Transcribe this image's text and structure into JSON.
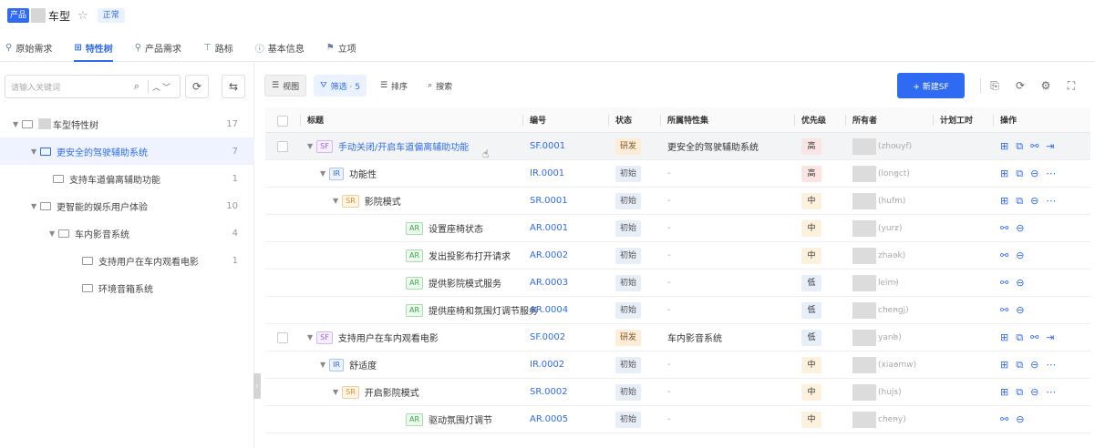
{
  "header": {
    "product_badge": "产品",
    "model_name": "车型",
    "status": "正常"
  },
  "tabs": [
    {
      "label": "原始需求",
      "icon": "pin-icon"
    },
    {
      "label": "特性树",
      "icon": "tree-icon",
      "active": true
    },
    {
      "label": "产品需求",
      "icon": "pin-icon"
    },
    {
      "label": "路标",
      "icon": "signpost-icon"
    },
    {
      "label": "基本信息",
      "icon": "info-icon"
    },
    {
      "label": "立项",
      "icon": "flag-icon"
    }
  ],
  "left_panel": {
    "search_placeholder": "请输入关键词",
    "tree": [
      {
        "label": "车型特性树",
        "count": "17",
        "level": 0
      },
      {
        "label": "更安全的驾驶辅助系统",
        "count": "7",
        "level": 1,
        "selected": true
      },
      {
        "label": "支持车道偏离辅助功能",
        "count": "1",
        "level": 2
      },
      {
        "label": "更智能的娱乐用户体验",
        "count": "10",
        "level": 1
      },
      {
        "label": "车内影音系统",
        "count": "4",
        "level": 2
      },
      {
        "label": "支持用户在车内观看电影",
        "count": "1",
        "level": 3
      },
      {
        "label": "环境音箱系统",
        "count": "",
        "level": 3
      }
    ]
  },
  "toolbar": {
    "view": "视图",
    "filter": "筛选 · 5",
    "sort": "排序",
    "search": "搜索",
    "new_button": "+ 新建SF"
  },
  "table": {
    "columns": [
      "标题",
      "编号",
      "状态",
      "所属特性集",
      "优先级",
      "所有者",
      "计划工时",
      "操作"
    ],
    "rows": [
      {
        "type": "SF",
        "title": "手动关闭/开启车道偏离辅助功能",
        "code": "SF.0001",
        "status": "研发",
        "feature_set": "更安全的驾驶辅助系统",
        "priority": "高",
        "owner": "(zhouyf)",
        "hours": "-",
        "level": 0,
        "has_checkbox": true,
        "ops": [
          "tree",
          "copy",
          "split",
          "export"
        ]
      },
      {
        "type": "IR",
        "title": "功能性",
        "code": "IR.0001",
        "status": "初始",
        "feature_set": "-",
        "priority": "高",
        "owner": "(longct)",
        "hours": "-",
        "level": 1,
        "ops": [
          "tree",
          "copy",
          "minus",
          "more"
        ]
      },
      {
        "type": "SR",
        "title": "影院模式",
        "code": "SR.0001",
        "status": "初始",
        "feature_set": "-",
        "priority": "中",
        "owner": "(hufm)",
        "hours": "-",
        "level": 2,
        "ops": [
          "tree",
          "copy",
          "minus",
          "more"
        ]
      },
      {
        "type": "AR",
        "title": "设置座椅状态",
        "code": "AR.0001",
        "status": "初始",
        "feature_set": "-",
        "priority": "中",
        "owner": "(yurz)",
        "hours": "-",
        "level": 3,
        "ops": [
          "split",
          "minus"
        ]
      },
      {
        "type": "AR",
        "title": "发出投影布打开请求",
        "code": "AR.0002",
        "status": "初始",
        "feature_set": "-",
        "priority": "中",
        "owner": "zhaok)",
        "hours": "-",
        "level": 3,
        "ops": [
          "split",
          "minus"
        ]
      },
      {
        "type": "AR",
        "title": "提供影院模式服务",
        "code": "AR.0003",
        "status": "初始",
        "feature_set": "-",
        "priority": "低",
        "owner": "leim)",
        "hours": "-",
        "level": 3,
        "ops": [
          "split",
          "minus"
        ]
      },
      {
        "type": "AR",
        "title": "提供座椅和氛围灯调节服务",
        "code": "AR.0004",
        "status": "初始",
        "feature_set": "-",
        "priority": "低",
        "owner": "chengj)",
        "hours": "-",
        "level": 3,
        "ops": [
          "split",
          "minus"
        ]
      },
      {
        "type": "SF",
        "title": "支持用户在车内观看电影",
        "code": "SF.0002",
        "status": "研发",
        "feature_set": "车内影音系统",
        "priority": "低",
        "owner": "yanb)",
        "hours": "-",
        "level": 0,
        "has_checkbox": true,
        "ops": [
          "tree",
          "copy",
          "split",
          "export"
        ]
      },
      {
        "type": "IR",
        "title": "舒适度",
        "code": "IR.0002",
        "status": "初始",
        "feature_set": "-",
        "priority": "中",
        "owner": "(xiaomw)",
        "hours": "-",
        "level": 1,
        "ops": [
          "tree",
          "copy",
          "minus",
          "more"
        ]
      },
      {
        "type": "SR",
        "title": "开启影院模式",
        "code": "SR.0002",
        "status": "初始",
        "feature_set": "-",
        "priority": "中",
        "owner": "(hujs)",
        "hours": "-",
        "level": 2,
        "ops": [
          "tree",
          "copy",
          "minus",
          "more"
        ]
      },
      {
        "type": "AR",
        "title": "驱动氛围灯调节",
        "code": "AR.0005",
        "status": "初始",
        "feature_set": "-",
        "priority": "中",
        "owner": "cheny)",
        "hours": "-",
        "level": 3,
        "ops": [
          "split",
          "minus"
        ]
      }
    ]
  },
  "colors": {
    "accent": "#2f6bf2"
  }
}
